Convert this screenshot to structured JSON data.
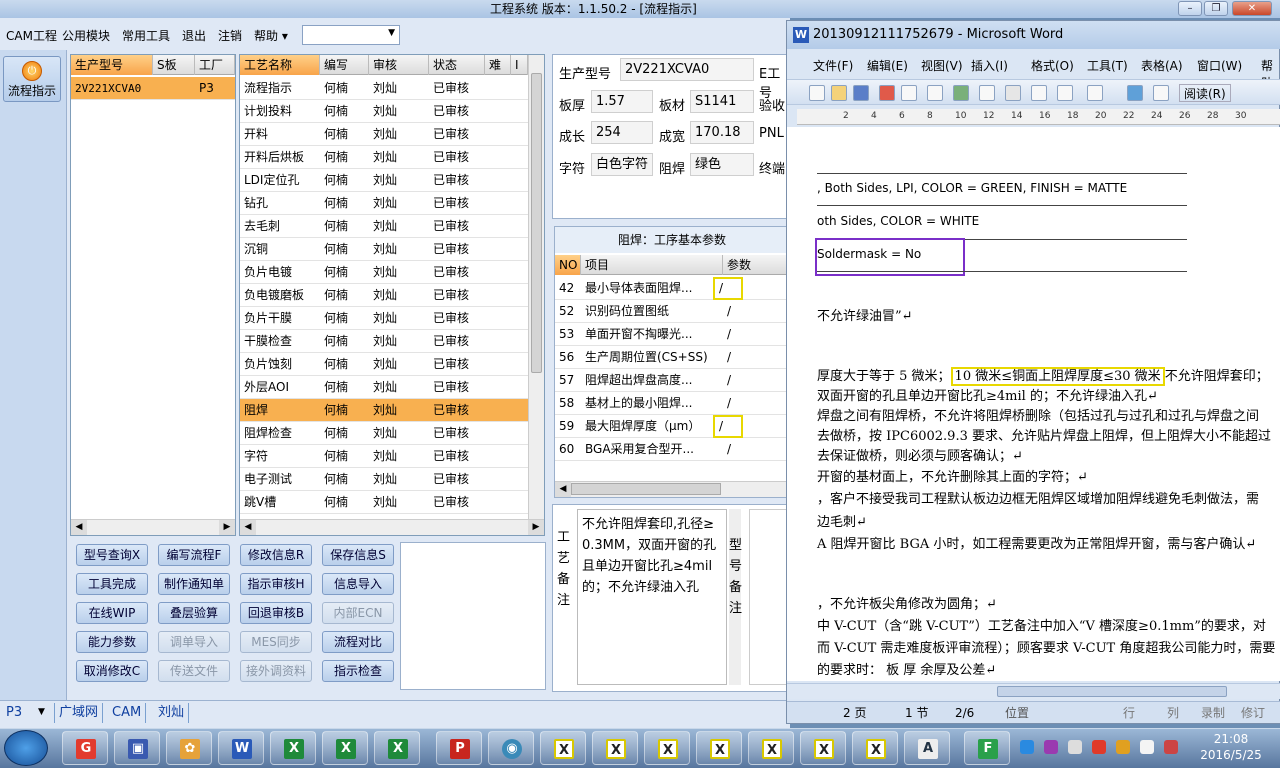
{
  "app": {
    "title": "工程系统   版本：1.1.50.2 - [流程指示]",
    "window_min": "–",
    "window_restore": "❐",
    "window_close": "✕"
  },
  "menu": {
    "items": [
      "CAM工程",
      "公用模块",
      "常用工具",
      "退出",
      "注销",
      "帮助 ▾"
    ],
    "combo_value": ""
  },
  "side": {
    "flow_button": "流程指示"
  },
  "product_list": {
    "headers": [
      "生产型号",
      "S板",
      "工厂"
    ],
    "rows": [
      {
        "model": "2V221XCVA0",
        "s": "",
        "factory": "P3"
      }
    ]
  },
  "process_list": {
    "headers": [
      "工艺名称",
      "编写",
      "审核",
      "状态",
      "难",
      "I"
    ],
    "rows": [
      {
        "name": "流程指示",
        "writer": "何楠",
        "reviewer": "刘灿",
        "status": "已审核"
      },
      {
        "name": "计划投料",
        "writer": "何楠",
        "reviewer": "刘灿",
        "status": "已审核"
      },
      {
        "name": "开料",
        "writer": "何楠",
        "reviewer": "刘灿",
        "status": "已审核"
      },
      {
        "name": "开料后烘板",
        "writer": "何楠",
        "reviewer": "刘灿",
        "status": "已审核"
      },
      {
        "name": "LDI定位孔",
        "writer": "何楠",
        "reviewer": "刘灿",
        "status": "已审核"
      },
      {
        "name": "钻孔",
        "writer": "何楠",
        "reviewer": "刘灿",
        "status": "已审核"
      },
      {
        "name": "去毛刺",
        "writer": "何楠",
        "reviewer": "刘灿",
        "status": "已审核"
      },
      {
        "name": "沉铜",
        "writer": "何楠",
        "reviewer": "刘灿",
        "status": "已审核"
      },
      {
        "name": "负片电镀",
        "writer": "何楠",
        "reviewer": "刘灿",
        "status": "已审核"
      },
      {
        "name": "负电镀磨板",
        "writer": "何楠",
        "reviewer": "刘灿",
        "status": "已审核"
      },
      {
        "name": "负片干膜",
        "writer": "何楠",
        "reviewer": "刘灿",
        "status": "已审核"
      },
      {
        "name": "干膜检查",
        "writer": "何楠",
        "reviewer": "刘灿",
        "status": "已审核"
      },
      {
        "name": "负片蚀刻",
        "writer": "何楠",
        "reviewer": "刘灿",
        "status": "已审核"
      },
      {
        "name": "外层AOI",
        "writer": "何楠",
        "reviewer": "刘灿",
        "status": "已审核"
      },
      {
        "name": "阻焊",
        "writer": "何楠",
        "reviewer": "刘灿",
        "status": "已审核"
      },
      {
        "name": "阻焊检查",
        "writer": "何楠",
        "reviewer": "刘灿",
        "status": "已审核"
      },
      {
        "name": "字符",
        "writer": "何楠",
        "reviewer": "刘灿",
        "status": "已审核"
      },
      {
        "name": "电子测试",
        "writer": "何楠",
        "reviewer": "刘灿",
        "status": "已审核"
      },
      {
        "name": "跳V槽",
        "writer": "何楠",
        "reviewer": "刘灿",
        "status": "已审核"
      }
    ]
  },
  "info": {
    "model_label": "生产型号",
    "model_value": "2V221XCVA0",
    "e_label": "E工号",
    "thick_label": "板厚",
    "thick_value": "1.57",
    "material_label": "板材",
    "material_value": "S1141",
    "accept_label": "验收",
    "len_label": "成长",
    "len_value": "254",
    "width_label": "成宽",
    "width_value": "170.18",
    "pnl_label": "PNL",
    "char_label": "字符",
    "char_value": "白色字符",
    "mask_label": "阻焊",
    "mask_value": "绿色",
    "term_label": "终端"
  },
  "params": {
    "title": "阻焊：工序基本参数",
    "headers": [
      "NO",
      "项目",
      "参数"
    ],
    "rows": [
      {
        "no": "42",
        "item": "最小导体表面阻焊...",
        "val": "/"
      },
      {
        "no": "52",
        "item": "识别码位置图纸",
        "val": "/"
      },
      {
        "no": "53",
        "item": "单面开窗不掏曝光...",
        "val": "/"
      },
      {
        "no": "56",
        "item": "生产周期位置(CS+SS)",
        "val": "/"
      },
      {
        "no": "57",
        "item": "阻焊超出焊盘高度...",
        "val": "/"
      },
      {
        "no": "58",
        "item": "基材上的最小阻焊...",
        "val": "/"
      },
      {
        "no": "59",
        "item": "最大阻焊厚度（μm）",
        "val": "/"
      },
      {
        "no": "60",
        "item": "BGA采用复合型开...",
        "val": "/"
      }
    ]
  },
  "notes": {
    "label_chars": [
      "工",
      "艺",
      "备",
      "注"
    ],
    "text": "不允许阻焊套印,孔径≥0.3MM，双面开窗的孔且单边开窗比孔≥4mil的；不允许绿油入孔",
    "label2_chars": [
      "型",
      "号",
      "备",
      "注"
    ]
  },
  "buttons": [
    {
      "label": "型号查询X",
      "enabled": true
    },
    {
      "label": "编写流程F",
      "enabled": true
    },
    {
      "label": "修改信息R",
      "enabled": true
    },
    {
      "label": "保存信息S",
      "enabled": true
    },
    {
      "label": "工具完成",
      "enabled": true
    },
    {
      "label": "制作通知单",
      "enabled": true
    },
    {
      "label": "指示审核H",
      "enabled": true
    },
    {
      "label": "信息导入",
      "enabled": true
    },
    {
      "label": "在线WIP",
      "enabled": true
    },
    {
      "label": "叠层验算",
      "enabled": true
    },
    {
      "label": "回退审核B",
      "enabled": true
    },
    {
      "label": "内部ECN",
      "enabled": false
    },
    {
      "label": "能力参数",
      "enabled": true
    },
    {
      "label": "调单导入",
      "enabled": false
    },
    {
      "label": "MES同步",
      "enabled": false
    },
    {
      "label": "流程对比",
      "enabled": true
    },
    {
      "label": "取消修改C",
      "enabled": true
    },
    {
      "label": "传送文件",
      "enabled": false
    },
    {
      "label": "接外调资料",
      "enabled": false
    },
    {
      "label": "指示检查",
      "enabled": true
    }
  ],
  "statusbar": {
    "factory": "P3",
    "tabs": [
      "广域网",
      "CAM",
      "刘灿"
    ]
  },
  "word": {
    "title": "20130912111752679 - Microsoft Word",
    "menu": [
      "文件(F)",
      "编辑(E)",
      "视图(V)",
      "插入(I)",
      "格式(O)",
      "工具(T)",
      "表格(A)",
      "窗口(W)",
      "帮助"
    ],
    "read_button": "阅读(R)",
    "ruler_nums": [
      "2",
      "4",
      "6",
      "8",
      "10",
      "12",
      "14",
      "16",
      "18",
      "20",
      "22",
      "24",
      "26",
      "28",
      "30"
    ],
    "lines": [
      ", Both Sides, LPI, COLOR = GREEN, FINISH = MATTE",
      "oth Sides, COLOR = WHITE",
      "Soldermask = No",
      "不允许绿油冒”↵",
      "厚度大于等于 5 微米；",
      "10 微米≤铜面上阻焊厚度≤30 微米",
      "不允许阻焊套印；",
      "双面开窗的孔且单边开窗比孔≥4mil 的；不允许绿油入孔↵",
      "焊盘之间有阻焊桥，不允许将阻焊桥删除（包括过孔与过孔和过孔与焊盘之间",
      "去做桥，按 IPC6002.9.3 要求、允许贴片焊盘上阻焊，但上阻焊大小不能超过",
      "去保证做桥，则必须与顾客确认；↵",
      "开窗的基材面上，不允许删除其上面的字符；↵",
      "，客户不接受我司工程默认板边边框无阻焊区域增加阻焊线避免毛刺做法，需",
      "边毛刺↵",
      "A 阻焊开窗比 BGA 小时，如工程需要更改为正常阻焊开窗，需与客户确认↵",
      "，不允许板尖角修改为圆角；↵",
      "中 V-CUT（含“跳 V-CUT”）工艺备注中加入“V 槽深度≥0.1mm”的要求，对",
      "而 V-CUT 需走难度板评审流程）；顾客要求 V-CUT 角度超我公司能力时，需要",
      "的要求时：        板  厚                    余厚及公差↵"
    ],
    "status": {
      "page": "2 页",
      "section": "1 节",
      "pages": "2/6",
      "position": "位置",
      "row": "行",
      "col": "列",
      "rec": "录制",
      "rev": "修订"
    }
  },
  "taskbar": {
    "time": "21:08",
    "date": "2016/5/25"
  },
  "colors": {
    "selected_row": "#f8b050",
    "highlight_box": "#e8d800",
    "purple_box": "#7a2fc8"
  }
}
